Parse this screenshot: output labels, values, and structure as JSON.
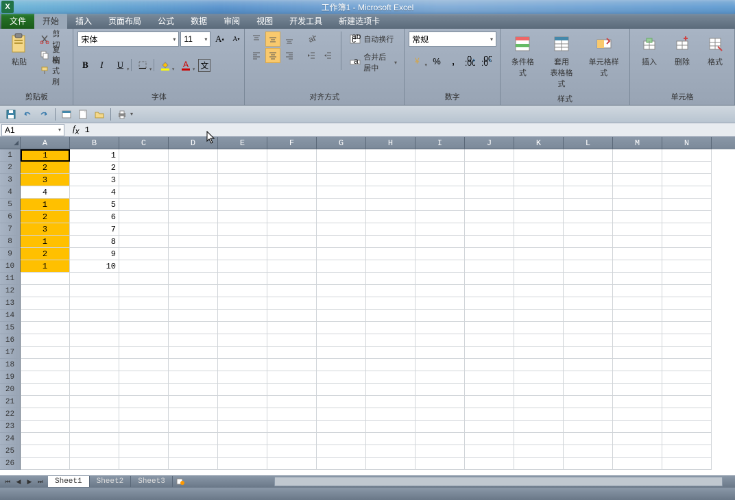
{
  "title": "工作簿1 - Microsoft Excel",
  "tabs": {
    "file": "文件",
    "items": [
      "开始",
      "插入",
      "页面布局",
      "公式",
      "数据",
      "审阅",
      "视图",
      "开发工具",
      "新建选项卡"
    ],
    "active": 0
  },
  "clipboard": {
    "label": "剪贴板",
    "paste": "粘贴",
    "cut": "剪切",
    "copy": "复制",
    "painter": "格式刷"
  },
  "font": {
    "label": "字体",
    "name": "宋体",
    "size": "11"
  },
  "align": {
    "label": "对齐方式",
    "wrap": "自动换行",
    "merge": "合并后居中"
  },
  "number": {
    "label": "数字",
    "format": "常规",
    "percent": "%",
    "comma": ","
  },
  "styles": {
    "label": "样式",
    "cond": "条件格式",
    "table": "套用\n表格格式",
    "cell": "单元格样式"
  },
  "cells_group": {
    "label": "单元格",
    "insert": "插入",
    "delete": "删除",
    "format": "格式"
  },
  "namebox": "A1",
  "formula": "1",
  "columns": [
    "A",
    "B",
    "C",
    "D",
    "E",
    "F",
    "G",
    "H",
    "I",
    "J",
    "K",
    "L",
    "M",
    "N"
  ],
  "rows": 26,
  "data": {
    "A": [
      "1",
      "2",
      "3",
      "4",
      "1",
      "2",
      "3",
      "1",
      "2",
      "1"
    ],
    "B": [
      "1",
      "2",
      "3",
      "4",
      "5",
      "6",
      "7",
      "8",
      "9",
      "10"
    ]
  },
  "highlight_A": [
    true,
    true,
    true,
    false,
    true,
    true,
    true,
    true,
    true,
    true
  ],
  "sheets": [
    "Sheet1",
    "Sheet2",
    "Sheet3"
  ],
  "active_sheet": 0
}
